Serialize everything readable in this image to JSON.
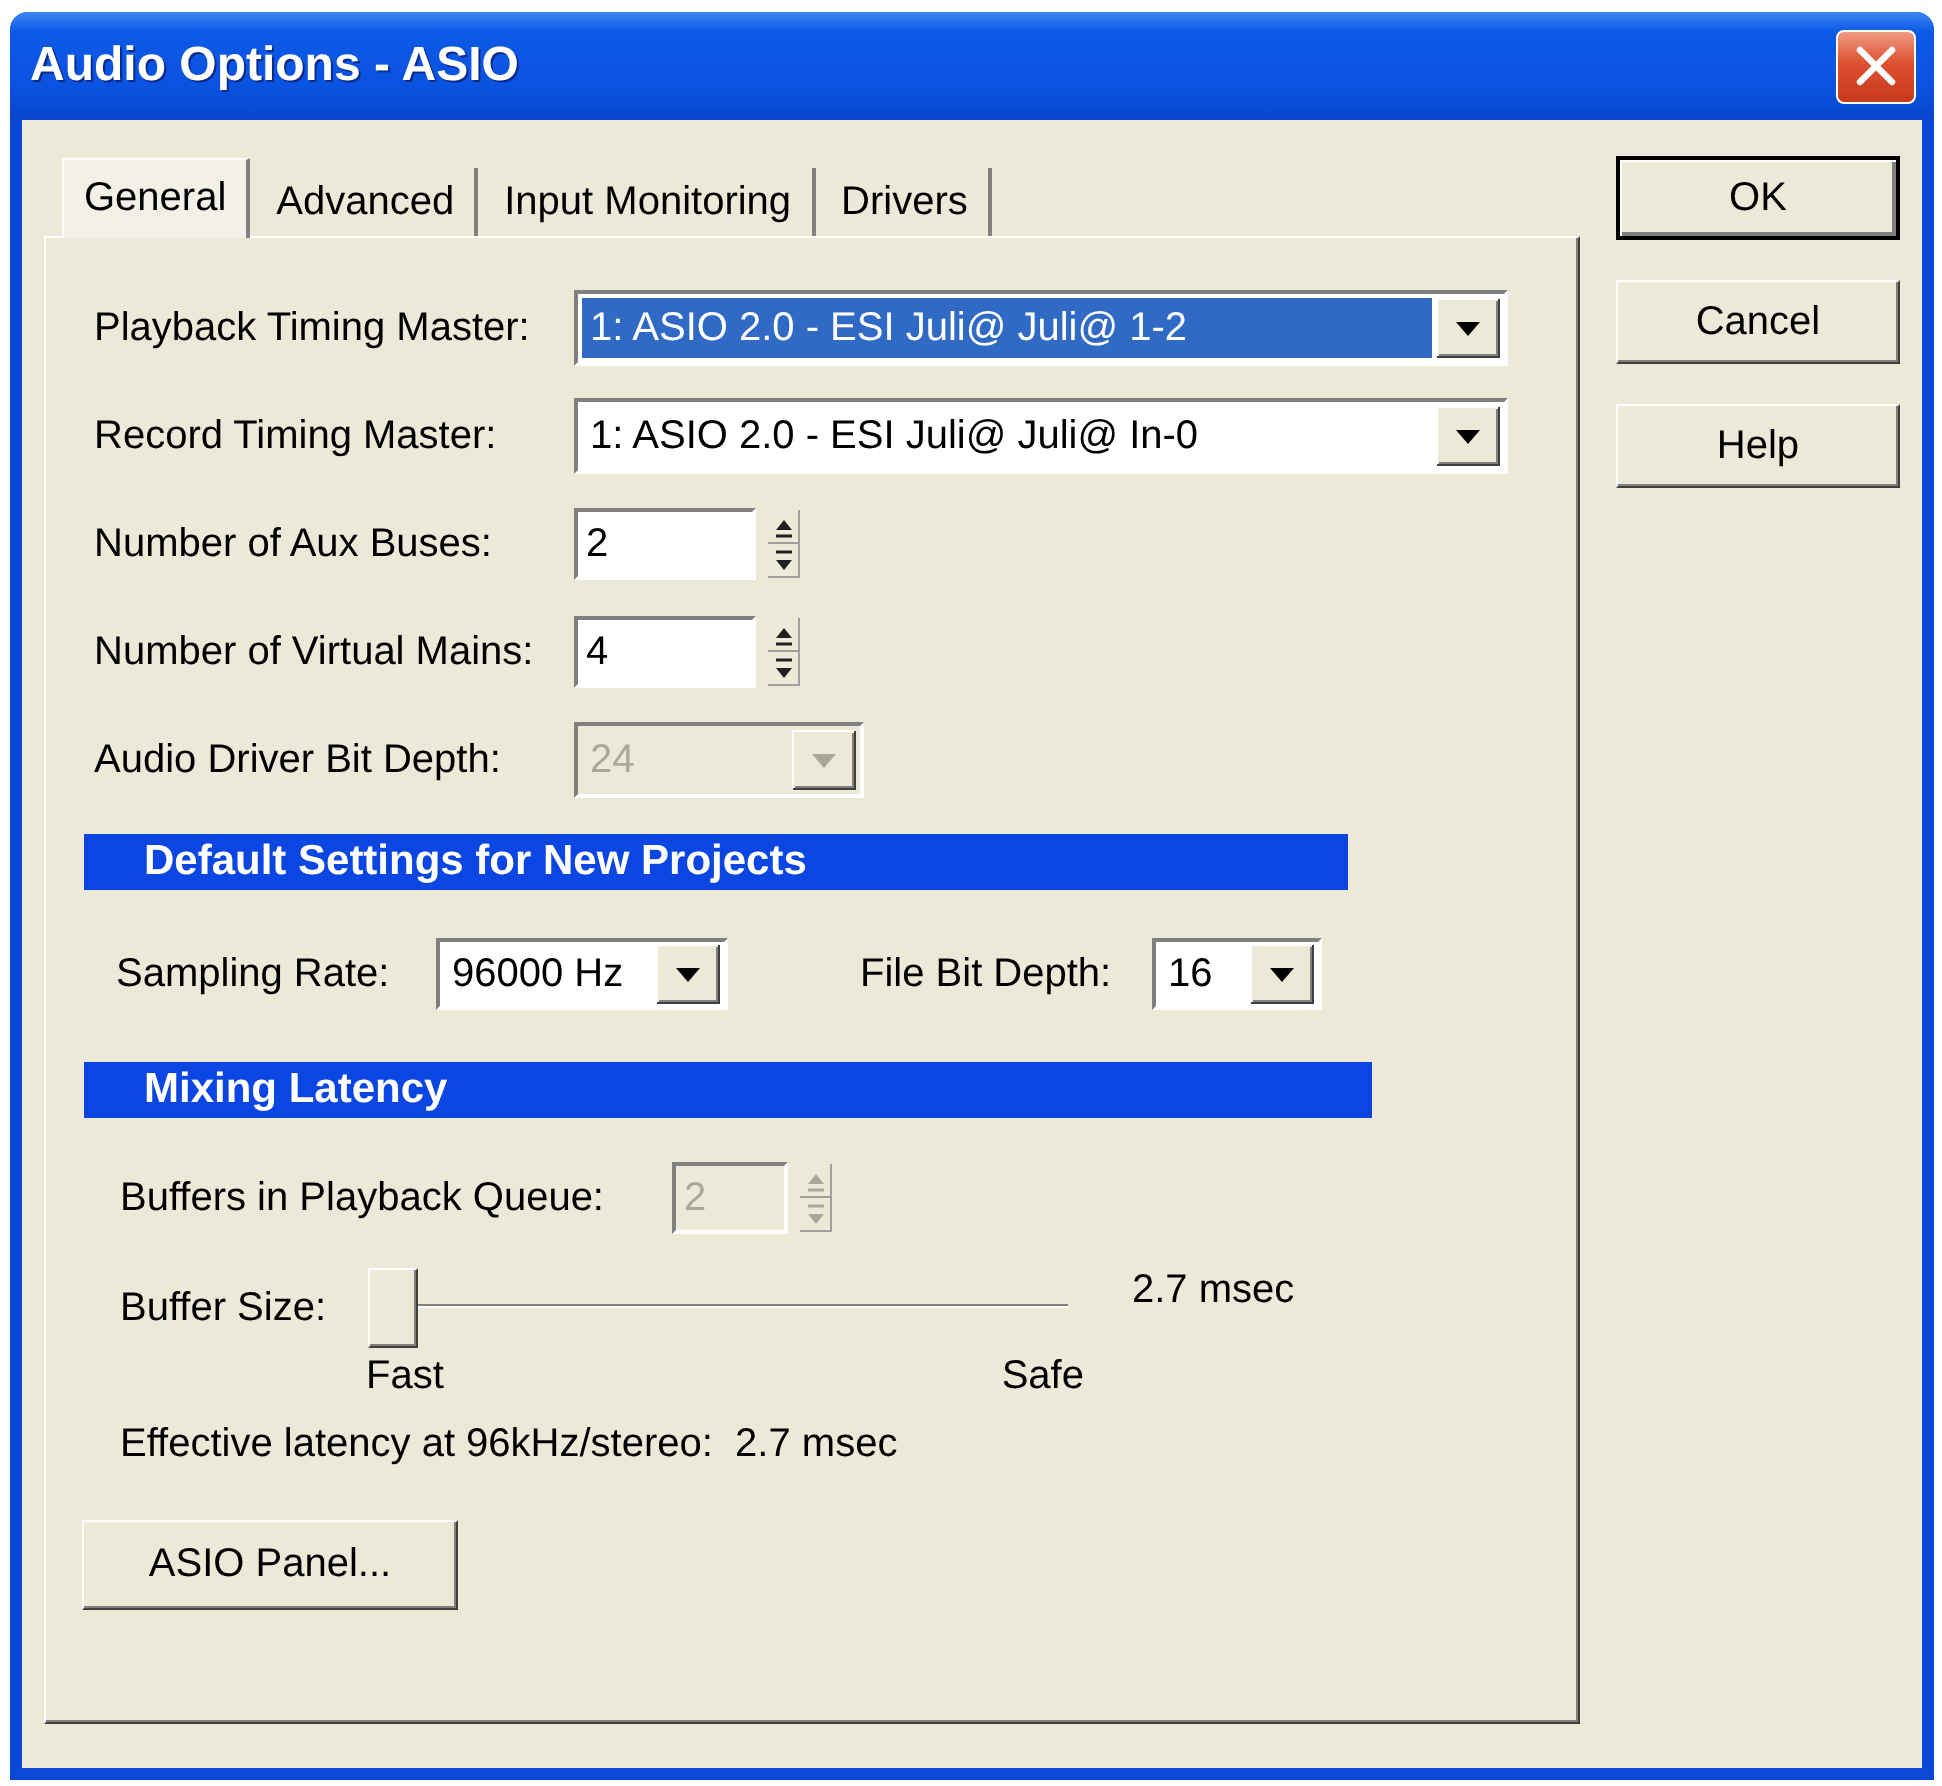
{
  "window": {
    "title": "Audio Options - ASIO"
  },
  "tabs": [
    {
      "label": "General",
      "selected": true
    },
    {
      "label": "Advanced",
      "selected": false
    },
    {
      "label": "Input Monitoring",
      "selected": false
    },
    {
      "label": "Drivers",
      "selected": false
    }
  ],
  "general": {
    "fields": [
      {
        "kind": "dropdown",
        "label": "Playback Timing Master:",
        "value": "1: ASIO 2.0 - ESI Juli@ Juli@ 1-2",
        "focused": true,
        "disabled": false
      },
      {
        "kind": "dropdown",
        "label": "Record Timing Master:",
        "value": "1: ASIO 2.0 - ESI Juli@ Juli@ In-0",
        "focused": false,
        "disabled": false
      },
      {
        "kind": "spinner",
        "label": "Number of Aux Buses:",
        "value": "2",
        "focused": false,
        "disabled": false
      },
      {
        "kind": "spinner",
        "label": "Number of Virtual Mains:",
        "value": "4",
        "focused": false,
        "disabled": false
      },
      {
        "kind": "dropdown",
        "label": "Audio Driver Bit Depth:",
        "value": "24",
        "focused": false,
        "disabled": true
      }
    ],
    "default_settings": {
      "heading": "Default Settings for New Projects",
      "sampling_rate": {
        "label": "Sampling Rate:",
        "value": "96000 Hz"
      },
      "file_bit_depth": {
        "label": "File Bit Depth:",
        "value": "16"
      }
    },
    "mixing_latency": {
      "heading": "Mixing Latency",
      "buffers": {
        "label": "Buffers in Playback Queue:",
        "value": "2",
        "disabled": true
      },
      "buffer_size": {
        "label": "Buffer Size:",
        "level": 0,
        "reading": "2.7 msec",
        "min_label": "Fast",
        "max_label": "Safe"
      },
      "effective_latency": "Effective latency at 96kHz/stereo:  2.7 msec"
    },
    "asio_panel_button": "ASIO Panel..."
  },
  "buttons": [
    {
      "label": "OK",
      "default": true
    },
    {
      "label": "Cancel",
      "default": false
    },
    {
      "label": "Help",
      "default": false
    }
  ]
}
